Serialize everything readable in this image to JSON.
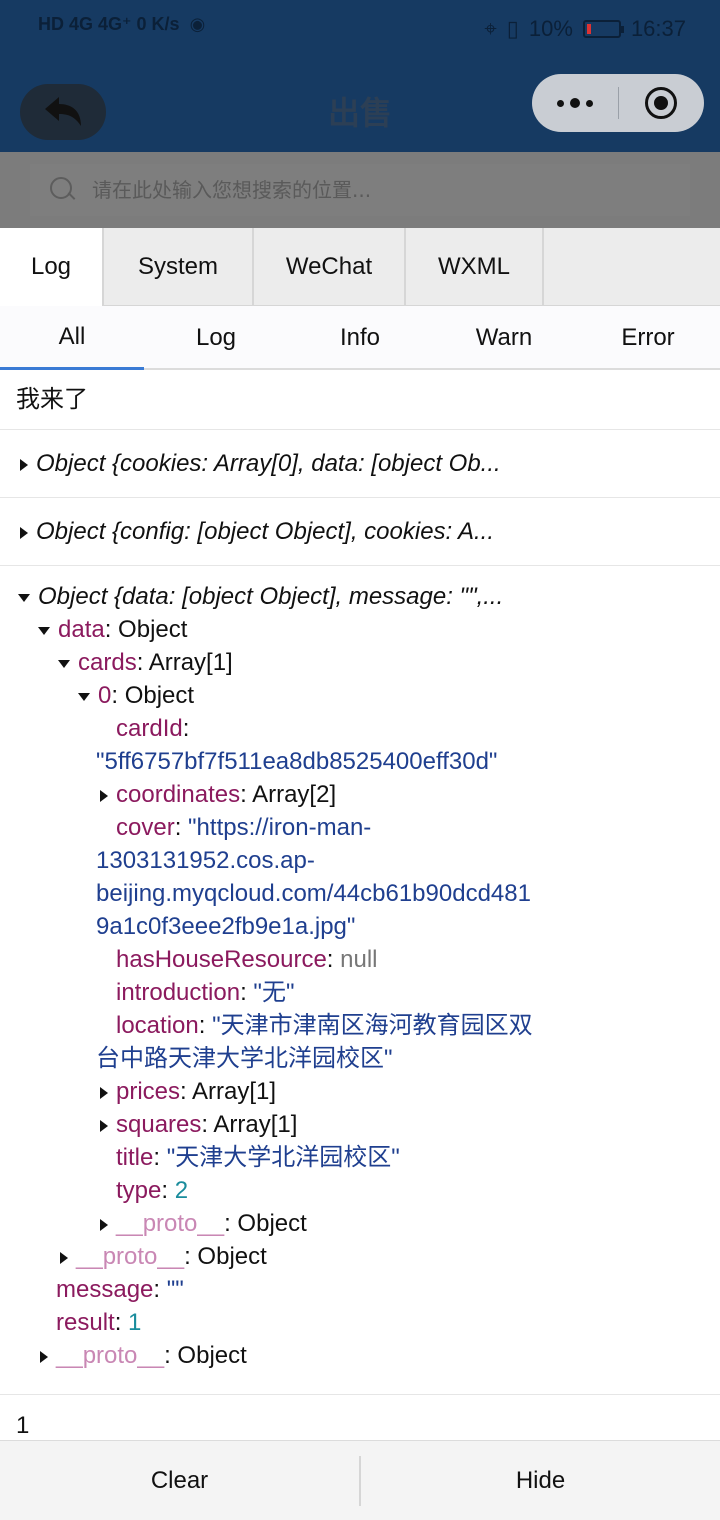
{
  "status": {
    "left_text": "HD 4G 4G⁺ 0 K/s",
    "battery": "10%",
    "time": "16:37"
  },
  "nav": {
    "title": "出售",
    "back_icon": "back-arrow-icon",
    "more_icon": "more-dots-icon",
    "close_icon": "target-close-icon"
  },
  "search": {
    "placeholder": "请在此处输入您想搜索的位置..."
  },
  "tabs": [
    "Log",
    "System",
    "WeChat",
    "WXML"
  ],
  "subtabs": [
    "All",
    "Log",
    "Info",
    "Warn",
    "Error"
  ],
  "log": {
    "entry1": "我来了",
    "entry2": "Object {cookies: Array[0], data: [object Ob...",
    "entry3": "Object {config: [object Object], cookies: A...",
    "tree_head": "Object {data: [object Object], message: \"\",...",
    "data_key": "data",
    "data_val": ": Object",
    "cards_key": "cards",
    "cards_val": ": Array[1]",
    "zero_key": "0",
    "zero_val": ": Object",
    "cardId_key": "cardId",
    "cardId_val": "\"5ff6757bf7f511ea8db8525400eff30d\"",
    "coord_key": "coordinates",
    "coord_val": ": Array[2]",
    "cover_key": "cover",
    "cover_l1": "\"https://iron-man-",
    "cover_l2": "1303131952.cos.ap-",
    "cover_l3": "beijing.myqcloud.com/44cb61b90dcd481",
    "cover_l4": "9a1c0f3eee2fb9e1a.jpg\"",
    "house_key": "hasHouseResource",
    "house_val": "null",
    "intro_key": "introduction",
    "intro_val": "\"无\"",
    "loc_key": "location",
    "loc_l1": "\"天津市津南区海河教育园区双",
    "loc_l2": "台中路天津大学北洋园校区\"",
    "prices_key": "prices",
    "prices_val": ": Array[1]",
    "squares_key": "squares",
    "squares_val": ": Array[1]",
    "title_key": "title",
    "title_val": "\"天津大学北洋园校区\"",
    "type_key": "type",
    "type_val": "2",
    "proto_key": "__proto__",
    "proto_val": ": Object",
    "message_key": "message",
    "message_val": "\"\"",
    "result_key": "result",
    "result_val": "1",
    "entry_last": "1"
  },
  "bottom": {
    "clear": "Clear",
    "hide": "Hide"
  }
}
